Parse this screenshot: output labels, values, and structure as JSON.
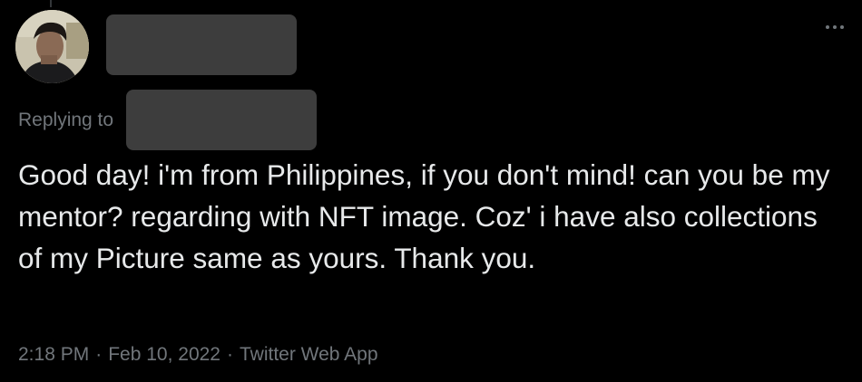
{
  "tweet": {
    "replying_label": "Replying to",
    "text": "Good day! i'm from Philippines, if you don't mind! can you be my mentor? regarding with NFT image. Coz' i have also collections of my Picture same as yours. Thank you.",
    "time": "2:18 PM",
    "separator": "·",
    "date": "Feb 10, 2022",
    "source": "Twitter Web App"
  },
  "icons": {
    "more": "more-horizontal-icon"
  },
  "colors": {
    "background": "#000000",
    "text": "#e7e9ea",
    "muted": "#71767b",
    "redaction": "#3d3d3d"
  }
}
